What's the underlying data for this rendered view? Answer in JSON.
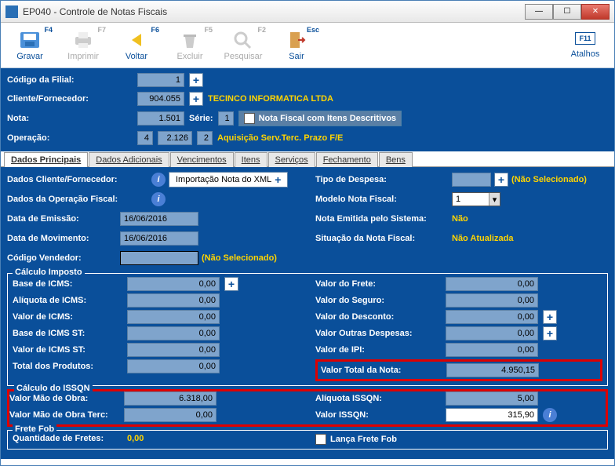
{
  "window": {
    "title": "EP040 - Controle de Notas Fiscais"
  },
  "toolbar": {
    "gravar": {
      "label": "Gravar",
      "fkey": "F4"
    },
    "imprimir": {
      "label": "Imprimir",
      "fkey": "F7"
    },
    "voltar": {
      "label": "Voltar",
      "fkey": "F6"
    },
    "excluir": {
      "label": "Excluir",
      "fkey": "F5"
    },
    "pesquisar": {
      "label": "Pesquisar",
      "fkey": "F2"
    },
    "sair": {
      "label": "Sair",
      "fkey": "Esc"
    },
    "atalhos": {
      "label": "Atalhos",
      "fkey": "F11"
    }
  },
  "header": {
    "codigo_filial_lbl": "Código da Filial:",
    "codigo_filial": "1",
    "cliente_fornecedor_lbl": "Cliente/Fornecedor:",
    "cliente_fornecedor": "904.055",
    "cliente_nome": "TECINCO INFORMATICA LTDA",
    "nota_lbl": "Nota:",
    "nota": "1.501",
    "serie_lbl": "Série:",
    "serie": "1",
    "nota_descritivos_lbl": "Nota Fiscal com Itens Descritivos",
    "operacao_lbl": "Operação:",
    "operacao_a": "4",
    "operacao_b": "2.126",
    "operacao_c": "2",
    "operacao_desc": "Aquisição Serv.Terc. Prazo F/E"
  },
  "tabs": {
    "principais": "Dados Principais",
    "adicionais": "Dados Adicionais",
    "vencimentos": "Vencimentos",
    "itens": "Itens",
    "servicos": "Serviços",
    "fechamento": "Fechamento",
    "bens": "Bens"
  },
  "details": {
    "dados_cliente_lbl": "Dados Cliente/Fornecedor:",
    "importacao_xml": "Importação Nota do XML",
    "dados_operacao_lbl": "Dados da Operação Fiscal:",
    "data_emissao_lbl": "Data de Emissão:",
    "data_emissao": "16/06/2016",
    "data_movimento_lbl": "Data de Movimento:",
    "data_movimento": "16/06/2016",
    "codigo_vendedor_lbl": "Código Vendedor:",
    "codigo_vendedor": "",
    "nao_selecionado": "(Não Selecionado)",
    "tipo_despesa_lbl": "Tipo de Despesa:",
    "tipo_despesa": "",
    "modelo_nota_lbl": "Modelo Nota Fiscal:",
    "modelo_nota": "1",
    "emitida_sistema_lbl": "Nota Emitida pelo Sistema:",
    "emitida_sistema": "Não",
    "situacao_lbl": "Situação da Nota Fiscal:",
    "situacao": "Não Atualizada"
  },
  "calculo_imposto": {
    "legend": "Cálculo Imposto",
    "base_icms_lbl": "Base de ICMS:",
    "base_icms": "0,00",
    "aliquota_icms_lbl": "Alíquota de ICMS:",
    "aliquota_icms": "0,00",
    "valor_icms_lbl": "Valor de ICMS:",
    "valor_icms": "0,00",
    "base_icms_st_lbl": "Base de ICMS ST:",
    "base_icms_st": "0,00",
    "valor_icms_st_lbl": "Valor de ICMS ST:",
    "valor_icms_st": "0,00",
    "total_produtos_lbl": "Total dos Produtos:",
    "total_produtos": "0,00",
    "valor_frete_lbl": "Valor do Frete:",
    "valor_frete": "0,00",
    "valor_seguro_lbl": "Valor do Seguro:",
    "valor_seguro": "0,00",
    "valor_desconto_lbl": "Valor do Desconto:",
    "valor_desconto": "0,00",
    "outras_despesas_lbl": "Valor Outras Despesas:",
    "outras_despesas": "0,00",
    "valor_ipi_lbl": "Valor de IPI:",
    "valor_ipi": "0,00",
    "valor_total_nota_lbl": "Valor Total da Nota:",
    "valor_total_nota": "4.950,15"
  },
  "calculo_issqn": {
    "legend": "Cálculo do ISSQN",
    "mao_obra_lbl": "Valor Mão de Obra:",
    "mao_obra": "6.318,00",
    "mao_obra_terc_lbl": "Valor Mão de Obra Terc:",
    "mao_obra_terc": "0,00",
    "aliquota_lbl": "Alíquota ISSQN:",
    "aliquota": "5,00",
    "valor_issqn_lbl": "Valor ISSQN:",
    "valor_issqn": "315,90"
  },
  "frete_fob": {
    "legend": "Frete Fob",
    "quantidade_lbl": "Quantidade de Fretes:",
    "quantidade": "0,00",
    "lanca_frete_lbl": "Lança Frete Fob"
  }
}
